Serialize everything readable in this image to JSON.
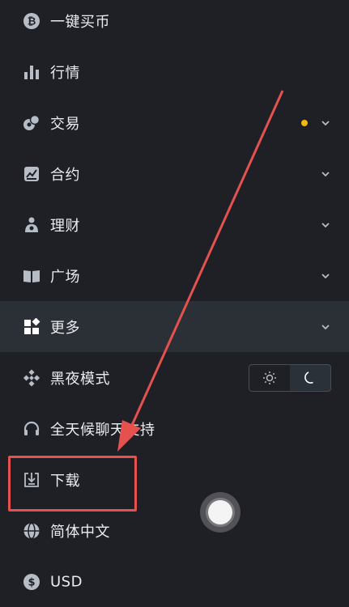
{
  "colors": {
    "background": "#1e2026",
    "active_row": "#2b2f36",
    "text": "#eaecef",
    "icon": "#b7bdc6",
    "accent_dot": "#f0b90b",
    "annotation": "#e5514e"
  },
  "menu": [
    {
      "id": "buy",
      "label": "一键买币",
      "icon": "bitcoin-icon",
      "expandable": false
    },
    {
      "id": "markets",
      "label": "行情",
      "icon": "bar-chart-icon",
      "expandable": false
    },
    {
      "id": "trade",
      "label": "交易",
      "icon": "trade-icon",
      "expandable": true,
      "badge": true
    },
    {
      "id": "futures",
      "label": "合约",
      "icon": "futures-icon",
      "expandable": true
    },
    {
      "id": "earn",
      "label": "理财",
      "icon": "earn-icon",
      "expandable": true
    },
    {
      "id": "square",
      "label": "广场",
      "icon": "book-icon",
      "expandable": true
    },
    {
      "id": "more",
      "label": "更多",
      "icon": "grid-icon",
      "expandable": true,
      "active": true
    },
    {
      "id": "dark",
      "label": "黑夜模式",
      "icon": "binance-logo-icon",
      "expandable": false
    },
    {
      "id": "support",
      "label": "全天候聊天支持",
      "icon": "headset-icon",
      "expandable": false
    },
    {
      "id": "download",
      "label": "下载",
      "icon": "download-icon",
      "expandable": false
    },
    {
      "id": "language",
      "label": "简体中文",
      "icon": "globe-icon",
      "expandable": false
    },
    {
      "id": "currency",
      "label": "USD",
      "icon": "dollar-icon",
      "expandable": false
    }
  ],
  "theme_toggle": {
    "options": [
      "sun-icon",
      "moon-icon"
    ],
    "selected": "moon-icon"
  }
}
